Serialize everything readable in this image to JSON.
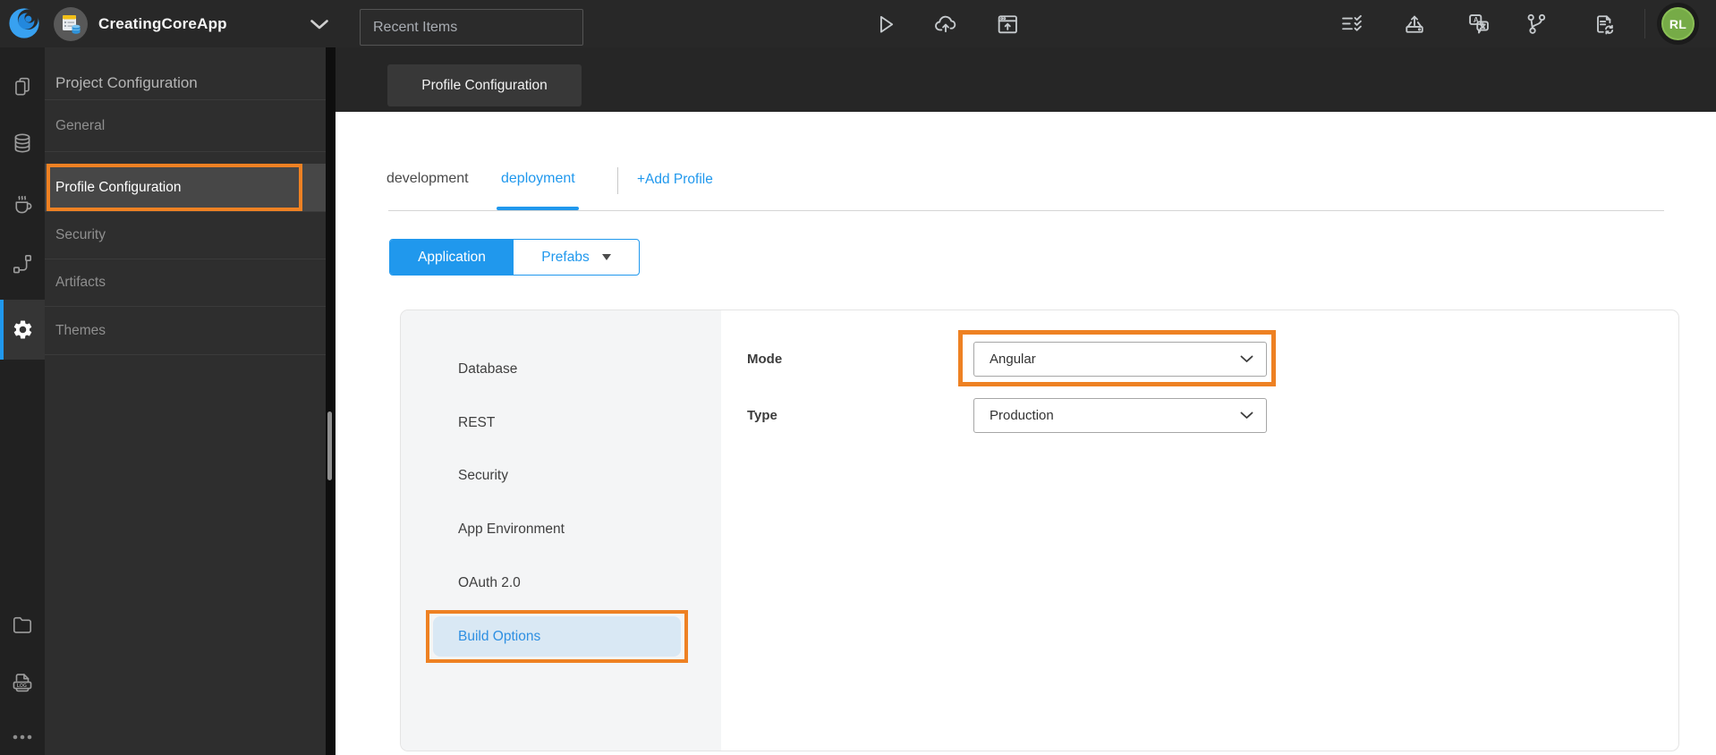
{
  "topbar": {
    "app_name": "CreatingCoreApp",
    "search_placeholder": "Recent Items",
    "avatar_initials": "RL"
  },
  "left_panel": {
    "title": "Project Configuration",
    "items": [
      "General",
      "Profile Configuration",
      "Security",
      "Artifacts",
      "Themes"
    ],
    "active_item": "Profile Configuration"
  },
  "main": {
    "page_tab": "Profile Configuration",
    "profile_tabs": [
      "development",
      "deployment"
    ],
    "active_profile_tab": "deployment",
    "add_profile_label": "+Add Profile",
    "scope_toggle": {
      "application": "Application",
      "prefabs": "Prefabs",
      "active": "Application"
    },
    "config_nav": [
      "Database",
      "REST",
      "Security",
      "App Environment",
      "OAuth 2.0",
      "Build Options"
    ],
    "active_config_nav": "Build Options",
    "form": {
      "mode_label": "Mode",
      "mode_value": "Angular",
      "type_label": "Type",
      "type_value": "Production"
    }
  },
  "icons": {
    "topbar_left": [
      "wavemaker-logo",
      "project-icon",
      "chevron-down-icon"
    ],
    "topbar_center": [
      "run-icon",
      "cloud-deploy-icon",
      "preview-window-icon"
    ],
    "topbar_right": [
      "checklist-icon",
      "export-icon",
      "translate-icon",
      "branch-icon",
      "file-sync-icon"
    ],
    "iconbar": [
      "pages-icon",
      "database-icon",
      "java-services-icon",
      "apis-icon",
      "settings-gear-icon",
      "file-explorer-icon",
      "logs-icon",
      "more-icon"
    ]
  },
  "colors": {
    "accent_blue": "#2098ed",
    "annotation_orange": "#ee8123",
    "avatar_green": "#76ab47",
    "nav_active_bg": "#d9e8f4",
    "topbar_bg": "#282828"
  }
}
